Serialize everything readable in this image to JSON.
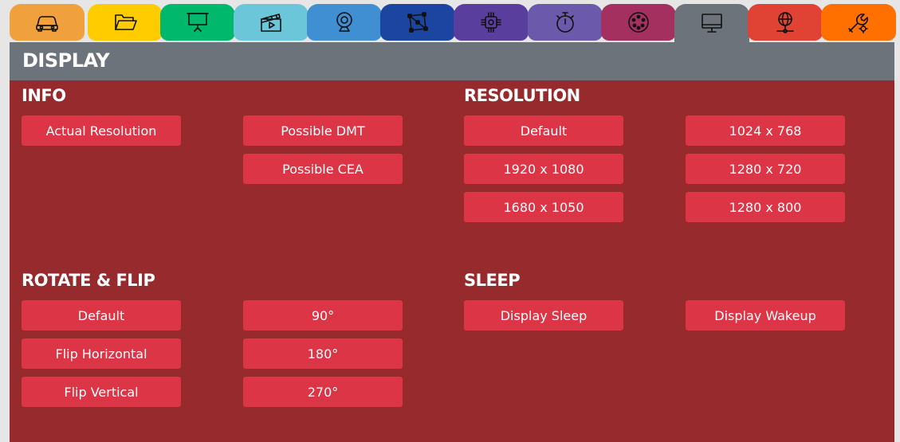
{
  "tabs": [
    {
      "id": "car",
      "icon": "car-icon",
      "color": "#f0a03c"
    },
    {
      "id": "folder",
      "icon": "folder-open-icon",
      "color": "#ffcc00"
    },
    {
      "id": "presentation",
      "icon": "projector-screen-icon",
      "color": "#00b86b"
    },
    {
      "id": "media",
      "icon": "clapperboard-icon",
      "color": "#6cc6da"
    },
    {
      "id": "camera",
      "icon": "webcam-icon",
      "color": "#3f8fd2"
    },
    {
      "id": "network",
      "icon": "network-nodes-icon",
      "color": "#1b45a0"
    },
    {
      "id": "chip",
      "icon": "cpu-chip-icon",
      "color": "#5a3e9e"
    },
    {
      "id": "timer",
      "icon": "stopwatch-icon",
      "color": "#6b5aab"
    },
    {
      "id": "connector",
      "icon": "din-connector-icon",
      "color": "#a3305f"
    },
    {
      "id": "display",
      "icon": "monitor-icon",
      "color": "#6c737a",
      "active": true
    },
    {
      "id": "globe",
      "icon": "globe-network-icon",
      "color": "#e04333"
    },
    {
      "id": "tools",
      "icon": "wrench-gear-icon",
      "color": "#ff7000"
    }
  ],
  "panel": {
    "title": "DISPLAY",
    "header_color": "#6c737a",
    "body_color": "#962a2c",
    "button_color": "#dc3545"
  },
  "sections": {
    "info": {
      "title": "INFO",
      "buttons": [
        "Actual Resolution",
        "Possible DMT",
        "Possible CEA"
      ]
    },
    "resolution": {
      "title": "RESOLUTION",
      "buttons": [
        "Default",
        "1024 x 768",
        "1920 x 1080",
        "1280 x 720",
        "1680 x 1050",
        "1280 x 800"
      ]
    },
    "rotate": {
      "title": "ROTATE & FLIP",
      "buttons": [
        "Default",
        "90°",
        "Flip Horizontal",
        "180°",
        "Flip Vertical",
        "270°"
      ]
    },
    "sleep": {
      "title": "SLEEP",
      "buttons": [
        "Display Sleep",
        "Display Wakeup"
      ]
    }
  }
}
